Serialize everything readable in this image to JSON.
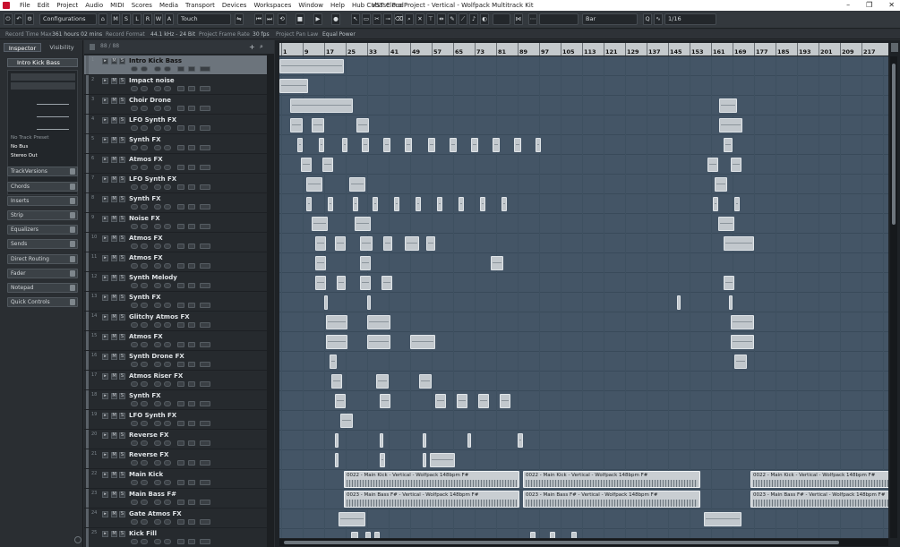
{
  "window": {
    "title": "Cubase Pro Project - Vertical - Wolfpack Multitrack Kit"
  },
  "menu": [
    "File",
    "Edit",
    "Project",
    "Audio",
    "MIDI",
    "Scores",
    "Media",
    "Transport",
    "Devices",
    "Workspaces",
    "Window",
    "Help",
    "Hub",
    "VST Cloud"
  ],
  "toolbar": {
    "configurations": "Configurations",
    "mode_buttons": [
      "M",
      "S",
      "L",
      "R",
      "W",
      "A"
    ],
    "automation_mode": "Touch",
    "snap_type": "Bar",
    "quantize": "1/16"
  },
  "info_line": {
    "record_time_max_label": "Record Time Max",
    "record_time_max_value": "361 hours 02 mins",
    "record_format_label": "Record Format",
    "record_format_value": "44.1 kHz - 24 Bit",
    "frame_rate_label": "Project Frame Rate",
    "frame_rate_value": "30 fps",
    "pan_law_label": "Project Pan Law",
    "pan_law_value": "Equal Power"
  },
  "inspector": {
    "tabs": [
      "Inspector",
      "Visibility"
    ],
    "track_name": "Intro Kick Bass",
    "track_preset": "No Track Preset",
    "input_routing": "No Bus",
    "output_routing": "Stereo Out",
    "sections": [
      "TrackVersions",
      "Chords",
      "Inserts",
      "Strip",
      "Equalizers",
      "Sends",
      "Direct Routing",
      "Fader",
      "Notepad",
      "Quick Controls"
    ]
  },
  "tracklist": {
    "header_count": "88 / 88",
    "tracks": [
      {
        "name": "Intro Kick Bass",
        "selected": true
      },
      {
        "name": "Impact noise"
      },
      {
        "name": "Choir Drone"
      },
      {
        "name": "LFO Synth FX"
      },
      {
        "name": "Synth FX"
      },
      {
        "name": "Atmos FX"
      },
      {
        "name": "LFO Synth FX"
      },
      {
        "name": "Synth FX"
      },
      {
        "name": "Noise FX"
      },
      {
        "name": "Atmos FX"
      },
      {
        "name": "Atmos FX"
      },
      {
        "name": "Synth Melody"
      },
      {
        "name": "Synth FX"
      },
      {
        "name": "Glitchy Atmos FX"
      },
      {
        "name": "Atmos FX"
      },
      {
        "name": "Synth Drone FX"
      },
      {
        "name": "Atmos Riser FX"
      },
      {
        "name": "Synth FX"
      },
      {
        "name": "LFO Synth FX"
      },
      {
        "name": "Reverse FX"
      },
      {
        "name": "Reverse FX"
      },
      {
        "name": "Main Kick"
      },
      {
        "name": "Main Bass F#"
      },
      {
        "name": "Gate Atmos FX"
      },
      {
        "name": "Kick Fill"
      }
    ]
  },
  "ruler": {
    "bars": [
      "1",
      "9",
      "17",
      "25",
      "33",
      "41",
      "49",
      "57",
      "65",
      "73",
      "81",
      "89",
      "97",
      "105",
      "113",
      "121",
      "129",
      "137",
      "145",
      "153",
      "161",
      "169",
      "177",
      "185",
      "193",
      "201",
      "209",
      "217"
    ]
  },
  "clips": {
    "main_kick": "0022 - Main Kick - Vertical - Wolfpack 148bpm F#",
    "main_bass": "0023 - Main Bass F# - Vertical - Wolfpack 148bpm F#"
  }
}
